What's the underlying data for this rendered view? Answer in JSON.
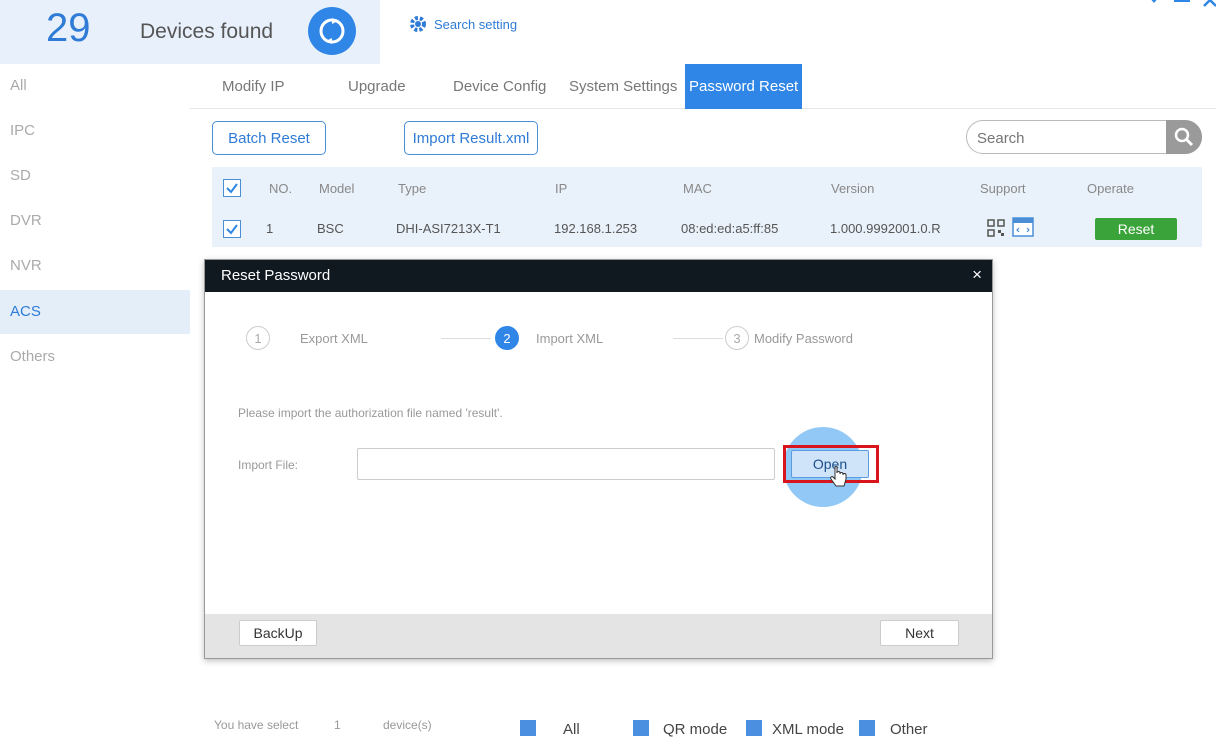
{
  "header": {
    "device_count": "29",
    "devices_found_label": "Devices found",
    "search_setting_label": "Search setting"
  },
  "sidebar": {
    "items": [
      {
        "label": "All"
      },
      {
        "label": "IPC"
      },
      {
        "label": "SD"
      },
      {
        "label": "DVR"
      },
      {
        "label": "NVR"
      },
      {
        "label": "ACS"
      },
      {
        "label": "Others"
      }
    ],
    "active": "ACS"
  },
  "tabs": [
    {
      "label": "Modify IP"
    },
    {
      "label": "Upgrade"
    },
    {
      "label": "Device Config"
    },
    {
      "label": "System Settings"
    },
    {
      "label": "Password Reset"
    }
  ],
  "toolbar": {
    "batch_reset_label": "Batch Reset",
    "import_result_label": "Import Result.xml",
    "search_placeholder": "Search"
  },
  "table": {
    "columns": [
      "NO.",
      "Model",
      "Type",
      "IP",
      "MAC",
      "Version",
      "Support",
      "Operate"
    ],
    "rows": [
      {
        "no": "1",
        "model": "BSC",
        "type": "DHI-ASI7213X-T1",
        "ip": "192.168.1.253",
        "mac": "08:ed:ed:a5:ff:85",
        "version": "1.000.9992001.0.R",
        "operate_label": "Reset",
        "checked": true
      }
    ],
    "header_checked": true
  },
  "dialog": {
    "title": "Reset Password",
    "close_glyph": "×",
    "steps": [
      {
        "number": "1",
        "label": "Export XML"
      },
      {
        "number": "2",
        "label": "Import XML"
      },
      {
        "number": "3",
        "label": "Modify Password"
      }
    ],
    "active_step": 2,
    "instruction": "Please import the authorization file named 'result'.",
    "import_file_label": "Import File:",
    "import_file_value": "",
    "open_label": "Open",
    "backup_label": "BackUp",
    "next_label": "Next"
  },
  "bottom_bar": {
    "you_have_select": "You have select",
    "selected_count": "1",
    "devices_suffix": "device(s)",
    "legend": [
      {
        "label": "All"
      },
      {
        "label": "QR mode"
      },
      {
        "label": "XML mode"
      },
      {
        "label": "Other"
      }
    ]
  },
  "colors": {
    "accent": "#2f86e6",
    "reset_green": "#3aa33a",
    "highlight_red": "#d8151c",
    "dialog_titlebar": "#101820"
  }
}
